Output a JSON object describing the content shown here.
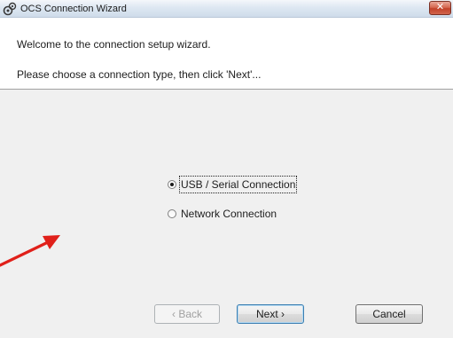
{
  "window": {
    "title": "OCS Connection Wizard",
    "close_symbol": "✕",
    "icon": "connection-gear-icon"
  },
  "header": {
    "welcome": "Welcome to the connection setup wizard.",
    "instruction": "Please choose a connection type, then click 'Next'..."
  },
  "options": [
    {
      "label": "USB / Serial Connection",
      "selected": true
    },
    {
      "label": "Network Connection",
      "selected": false
    }
  ],
  "buttons": {
    "back": "‹ Back",
    "next": "Next ›",
    "cancel": "Cancel"
  },
  "colors": {
    "annotation_arrow": "#e0201a",
    "panel_background": "#f0f0f0"
  }
}
